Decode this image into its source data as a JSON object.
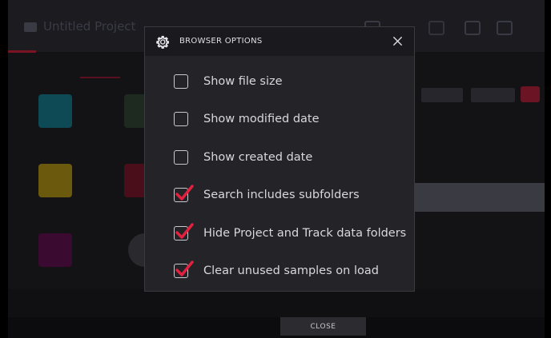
{
  "background": {
    "title": "Untitled Project"
  },
  "dialog": {
    "title": "BROWSER OPTIONS",
    "icon": "gear-icon",
    "close_icon": "close-icon",
    "options": [
      {
        "label": "Show file size",
        "checked": false
      },
      {
        "label": "Show modified date",
        "checked": false
      },
      {
        "label": "Show created date",
        "checked": false
      },
      {
        "label": "Search includes subfolders",
        "checked": true
      },
      {
        "label": "Hide Project and Track data folders",
        "checked": true
      },
      {
        "label": "Clear unused samples on load",
        "checked": true
      }
    ]
  },
  "footer": {
    "close_label": "CLOSE"
  },
  "colors": {
    "check_accent": "#e5213f",
    "dialog_bg": "#232328",
    "header_bg": "#1a1a1e"
  }
}
